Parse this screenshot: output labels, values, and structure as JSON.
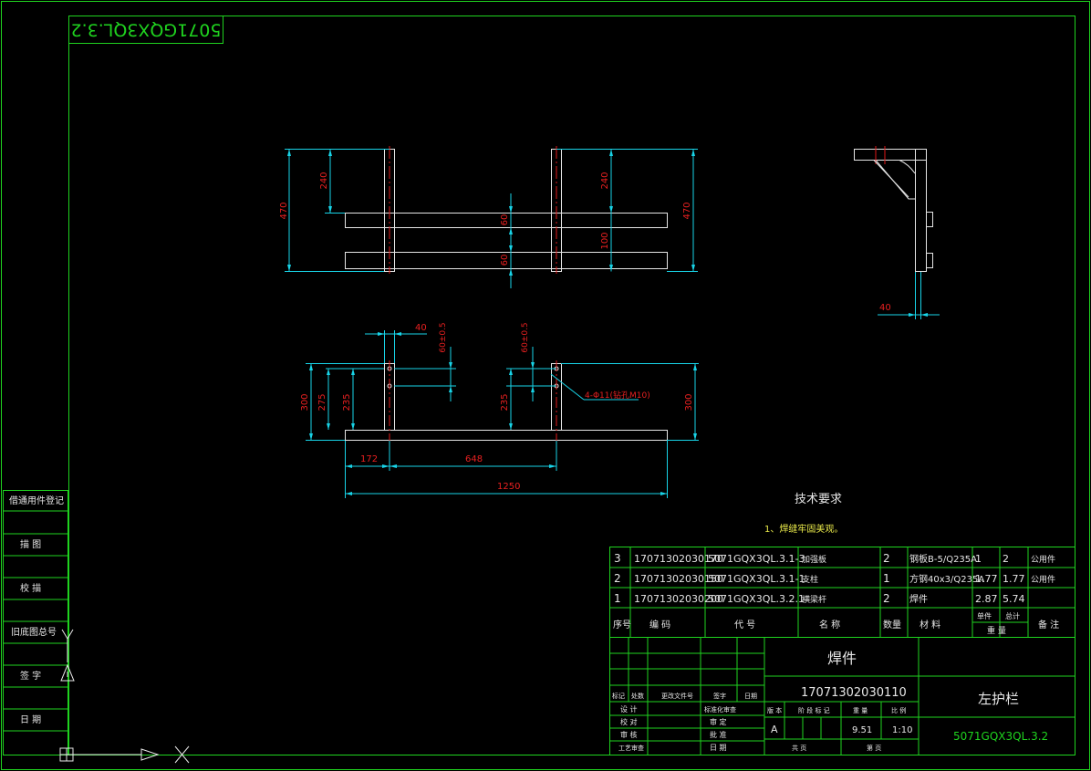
{
  "drawing_code_mirrored": "5071GQX3QL.3.2",
  "dims": {
    "d470_left": "470",
    "d240_left": "240",
    "d240_right": "240",
    "d470_right": "470",
    "d60_top": "60",
    "d60_bottom": "60",
    "d100": "100",
    "d40_side": "40",
    "d40_bottom": "40",
    "tol_left": "60±0.5",
    "tol_right": "60±0.5",
    "d300_left": "300",
    "d275": "275",
    "d235_left": "235",
    "d235_right": "235",
    "d300_right": "300",
    "hole_note": "4-Φ11(钻孔M10)",
    "d172": "172",
    "d648": "648",
    "d1250": "1250"
  },
  "tech": {
    "title": "技术要求",
    "item1": "1、焊缝牢固美观。"
  },
  "left_strip": [
    "借通用件登记",
    "描 图",
    "校 描",
    "旧底图总号",
    "签 字",
    "日 期"
  ],
  "bom": {
    "rows": [
      {
        "seq": "3",
        "code": "17071302030170",
        "drawing": "5071GQX3QL.3.1-3",
        "name": "加强板",
        "qty": "2",
        "material": "钢板B-5/Q235A",
        "unit": "1",
        "total": "2",
        "note": "公用件"
      },
      {
        "seq": "2",
        "code": "17071302030150",
        "drawing": "5071GQX3QL.3.1-1",
        "name": "支柱",
        "qty": "1",
        "material": "方钢40x3/Q235A",
        "unit": "1.77",
        "total": "1.77",
        "note": "公用件"
      },
      {
        "seq": "1",
        "code": "17071302030200",
        "drawing": "5071GQX3QL.3.2.1",
        "name": "横梁杆",
        "qty": "2",
        "material": "焊件",
        "unit": "2.87",
        "total": "5.74",
        "note": ""
      }
    ],
    "header": {
      "seq": "序号",
      "code": "编 码",
      "drawing": "代 号",
      "name": "名 称",
      "qty": "数量",
      "material": "材 料",
      "unit": "单件",
      "total": "总计",
      "mass": "重 量",
      "note": "备 注"
    }
  },
  "title_block": {
    "type": "焊件",
    "code": "17071302030110",
    "part_name": "左护栏",
    "drawing_no": "5071GQX3QL.3.2",
    "rev_headers": [
      "标记",
      "处数",
      "更改文件号",
      "签字",
      "日期"
    ],
    "sign_labels": [
      "设 计",
      "校 对",
      "审 核",
      "工艺审查"
    ],
    "sign_labels2": [
      "标准化审查",
      "审 定",
      "批 准",
      "日 期"
    ],
    "stage_label": "阶 段 标 记",
    "stage": "A",
    "weight_label": "重 量",
    "weight": "9.51",
    "scale_label": "比 例",
    "scale": "1:10",
    "sheets_label": "共 页",
    "sheet_label": "第 页",
    "version_label": "版 本"
  }
}
